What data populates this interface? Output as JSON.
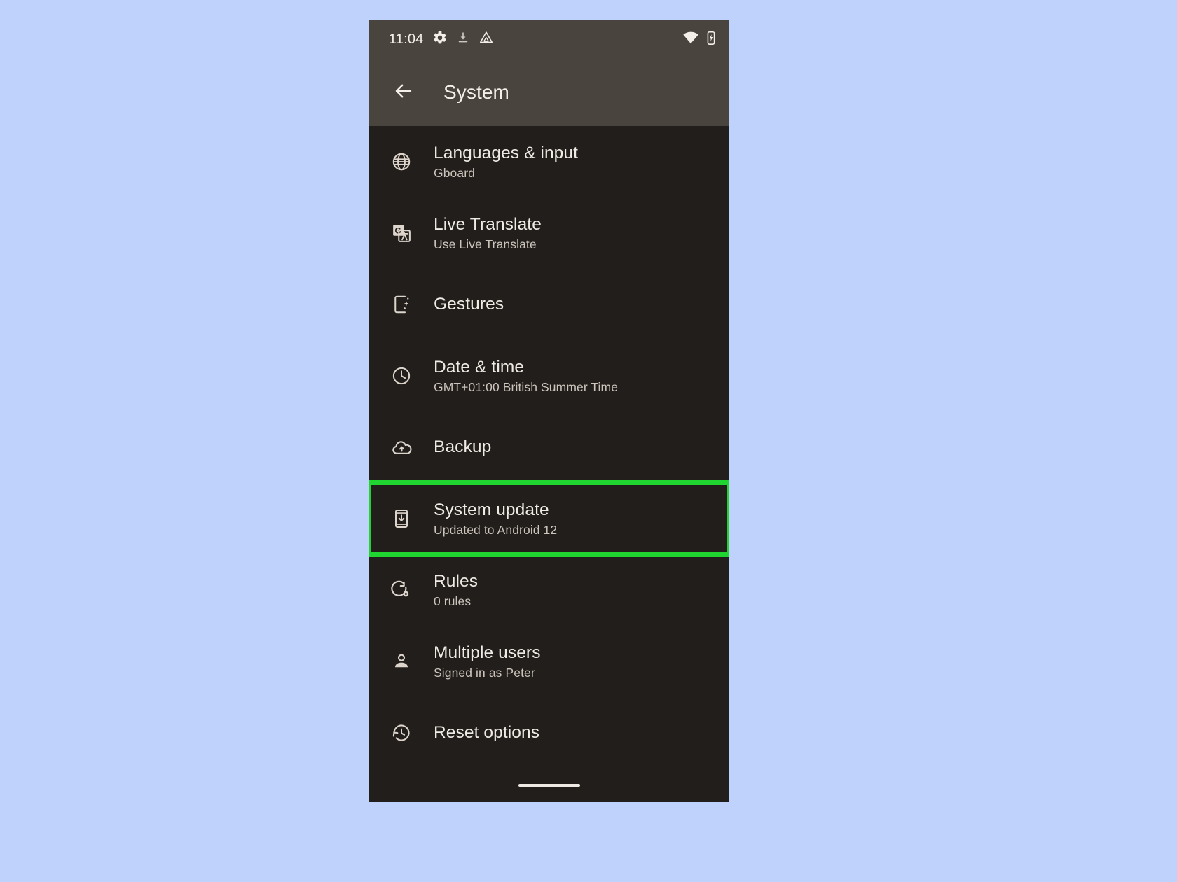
{
  "canvas": {
    "background_color": "#bfd2fb"
  },
  "status_bar": {
    "clock": "11:04",
    "background_color": "#4a443f",
    "left_icons": [
      {
        "name": "settings-gear-icon"
      },
      {
        "name": "download-icon"
      },
      {
        "name": "google-drive-icon"
      }
    ],
    "right_icons": [
      {
        "name": "wifi-icon"
      },
      {
        "name": "battery-charging-icon"
      }
    ]
  },
  "app_bar": {
    "back_icon": "arrow-back-icon",
    "title": "System"
  },
  "highlight": {
    "color": "#21d531",
    "target": "System update"
  },
  "list": {
    "items": [
      {
        "id": "languages-and-input",
        "icon": "globe-icon",
        "title": "Languages & input",
        "subtitle": "Gboard",
        "highlighted": false
      },
      {
        "id": "live-translate",
        "icon": "google-translate-icon",
        "title": "Live Translate",
        "subtitle": "Use Live Translate",
        "highlighted": false
      },
      {
        "id": "gestures",
        "icon": "gestures-phone-icon",
        "title": "Gestures",
        "subtitle": "",
        "highlighted": false
      },
      {
        "id": "date-and-time",
        "icon": "clock-icon",
        "title": "Date & time",
        "subtitle": "GMT+01:00 British Summer Time",
        "highlighted": false
      },
      {
        "id": "backup",
        "icon": "cloud-upload-icon",
        "title": "Backup",
        "subtitle": "",
        "highlighted": false
      },
      {
        "id": "system-update",
        "icon": "system-update-phone-icon",
        "title": "System update",
        "subtitle": "Updated to Android 12",
        "highlighted": true
      },
      {
        "id": "rules",
        "icon": "rules-gear-loop-icon",
        "title": "Rules",
        "subtitle": "0 rules",
        "highlighted": false
      },
      {
        "id": "multiple-users",
        "icon": "person-icon",
        "title": "Multiple users",
        "subtitle": "Signed in as Peter",
        "highlighted": false
      },
      {
        "id": "reset-options",
        "icon": "history-restore-icon",
        "title": "Reset options",
        "subtitle": "",
        "highlighted": false
      }
    ]
  },
  "nav_bar": {
    "home_indicator": "home-gesture-pill"
  }
}
